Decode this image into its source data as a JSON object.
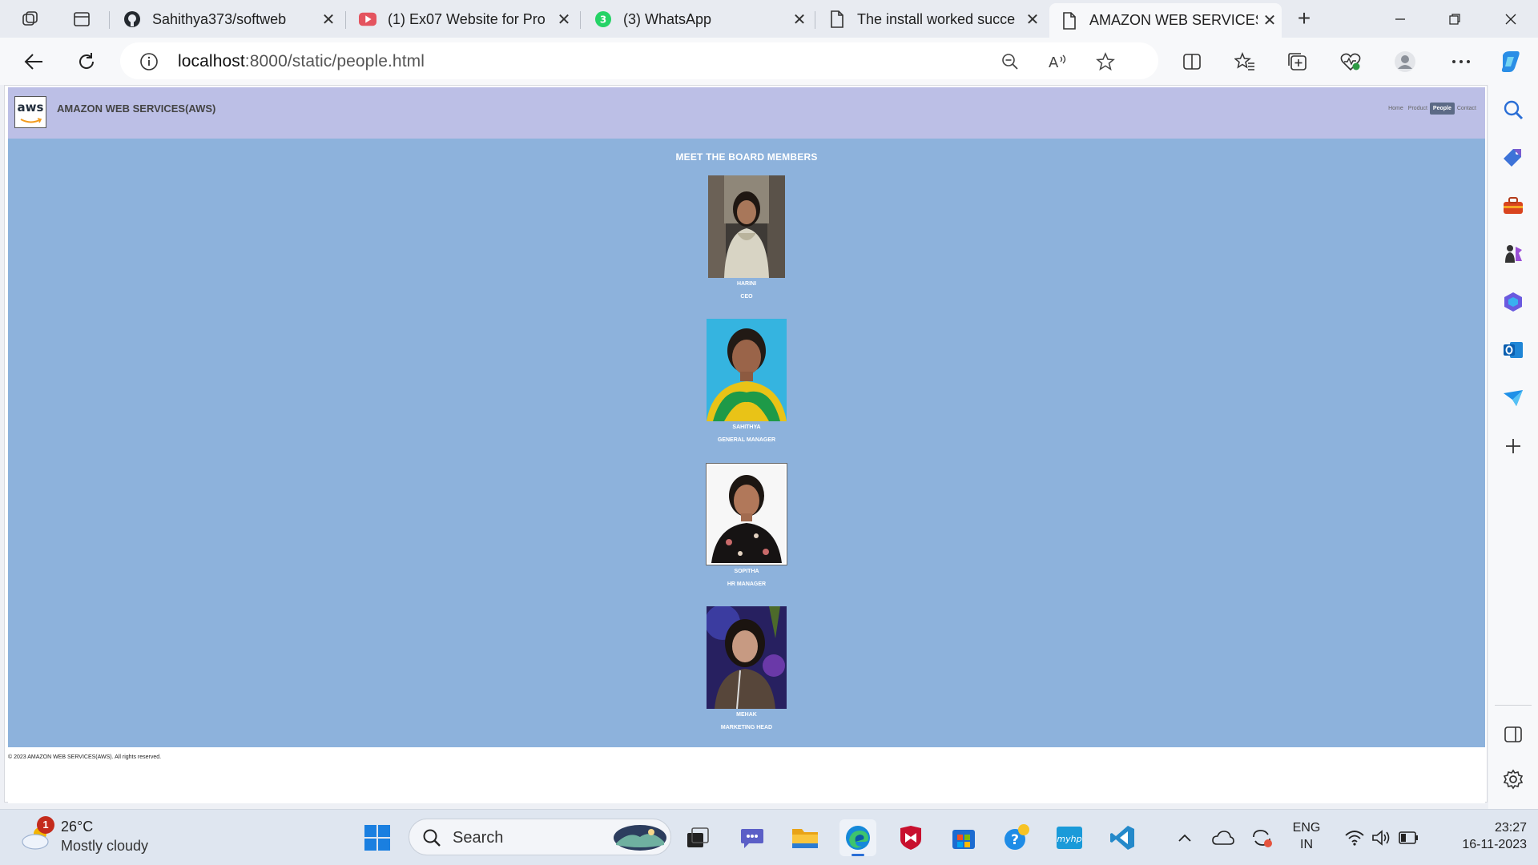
{
  "browser": {
    "tabs": [
      {
        "title": "Sahithya373/softweb",
        "icon": "github-icon"
      },
      {
        "title": "(1) Ex07 Website for Pro",
        "icon": "youtube-icon"
      },
      {
        "title": "(3) WhatsApp",
        "icon": "whatsapp-icon",
        "badge": "3"
      },
      {
        "title": "The install worked succe",
        "icon": "page-icon"
      },
      {
        "title": "AMAZON WEB SERVICES",
        "icon": "page-icon",
        "active": true
      }
    ],
    "url_host": "localhost",
    "url_path": ":8000/static/people.html"
  },
  "site": {
    "logo": "aws",
    "title": "AMAZON WEB SERVICES(AWS)",
    "nav": [
      "Home",
      "Product",
      "People",
      "Contact"
    ],
    "active_nav": "People",
    "heading": "MEET THE BOARD MEMBERS",
    "members": [
      {
        "name": "HARINI",
        "role": "CEO"
      },
      {
        "name": "SAHITHYA",
        "role": "GENERAL MANAGER"
      },
      {
        "name": "SOPITHA",
        "role": "HR MANAGER"
      },
      {
        "name": "MEHAK",
        "role": "MARKETING HEAD"
      }
    ],
    "footer": "© 2023 AMAZON WEB SERVICES(AWS). All rights reserved."
  },
  "taskbar": {
    "weather_temp": "26°C",
    "weather_desc": "Mostly cloudy",
    "weather_badge": "1",
    "search_label": "Search",
    "lang_top": "ENG",
    "lang_bottom": "IN",
    "time": "23:27",
    "date": "16-11-2023"
  },
  "colors": {
    "header_bg": "#bcbfe6",
    "main_bg": "#8db2dc",
    "nav_active": "#5c6a86"
  }
}
